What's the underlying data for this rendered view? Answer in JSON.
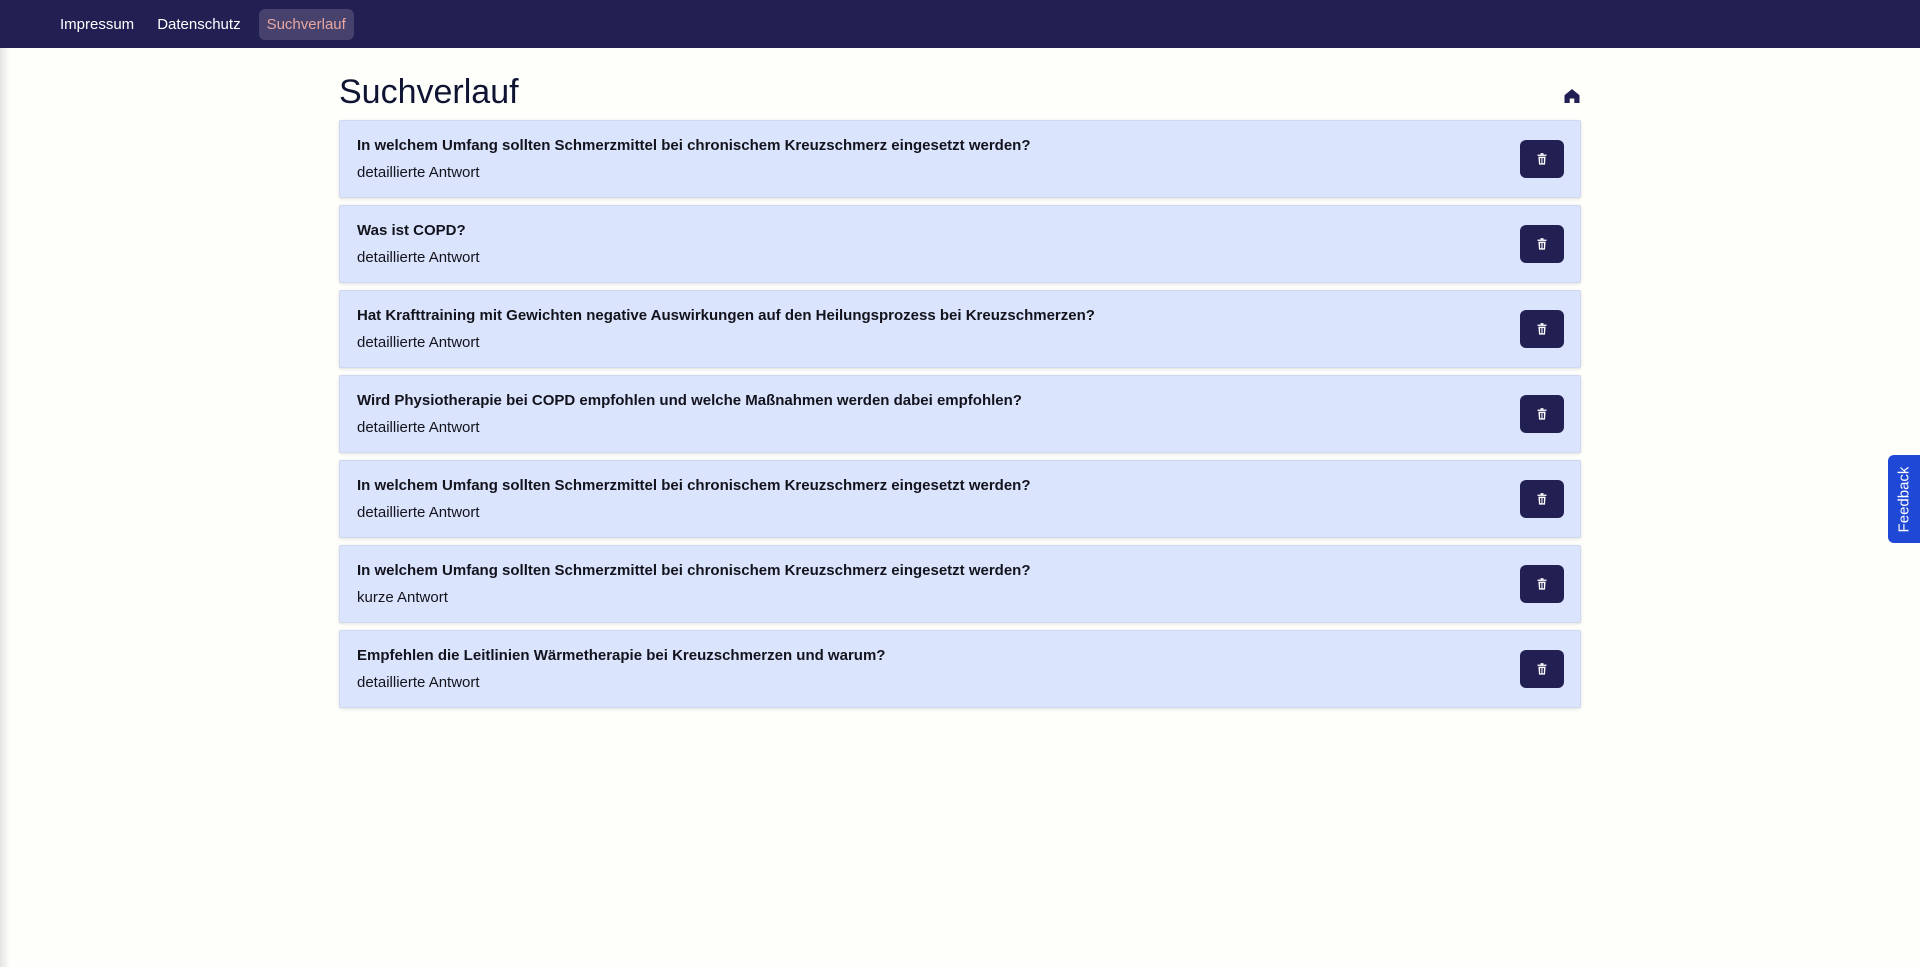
{
  "nav": {
    "items": [
      {
        "label": "Impressum",
        "active": false
      },
      {
        "label": "Datenschutz",
        "active": false
      },
      {
        "label": "Suchverlauf",
        "active": true
      }
    ]
  },
  "page": {
    "title": "Suchverlauf",
    "home_icon": "home-icon"
  },
  "history": [
    {
      "question": "In welchem Umfang sollten Schmerzmittel bei chronischem Kreuzschmerz eingesetzt werden?",
      "answer_type": "detaillierte Antwort"
    },
    {
      "question": "Was ist COPD?",
      "answer_type": "detaillierte Antwort"
    },
    {
      "question": "Hat Krafttraining mit Gewichten negative Auswirkungen auf den Heilungsprozess bei Kreuzschmerzen?",
      "answer_type": "detaillierte Antwort"
    },
    {
      "question": "Wird Physiotherapie bei COPD empfohlen und welche Maßnahmen werden dabei empfohlen?",
      "answer_type": "detaillierte Antwort"
    },
    {
      "question": "In welchem Umfang sollten Schmerzmittel bei chronischem Kreuzschmerz eingesetzt werden?",
      "answer_type": "detaillierte Antwort"
    },
    {
      "question": "In welchem Umfang sollten Schmerzmittel bei chronischem Kreuzschmerz eingesetzt werden?",
      "answer_type": "kurze Antwort"
    },
    {
      "question": "Empfehlen die Leitlinien Wärmetherapie bei Kreuzschmerzen und warum?",
      "answer_type": "detaillierte Antwort"
    }
  ],
  "feedback": {
    "label": "Feedback"
  },
  "colors": {
    "navbar": "#221f53",
    "item_bg": "#dbe4fd",
    "button": "#221f53",
    "feedback": "#1f48d6",
    "active_nav_text": "#e8a7a2"
  }
}
